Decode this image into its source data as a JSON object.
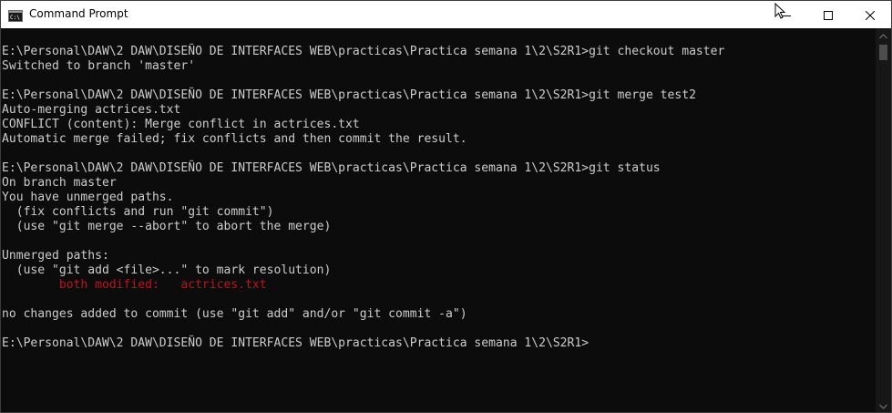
{
  "window": {
    "title": "Command Prompt",
    "icon": "cmd-icon"
  },
  "controls": {
    "minimize_icon": "minimize-icon",
    "maximize_icon": "maximize-icon",
    "close_icon": "close-icon"
  },
  "colors": {
    "console_bg": "#0c0c0c",
    "console_text": "#cccccc",
    "error_text": "#c50f1f",
    "titlebar_bg": "#ffffff"
  },
  "console": {
    "lines": [
      {
        "text": "E:\\Personal\\DAW\\2 DAW\\DISEÑO DE INTERFACES WEB\\practicas\\Practica semana 1\\2\\S2R1>git checkout master"
      },
      {
        "text": "Switched to branch 'master'"
      },
      {
        "text": ""
      },
      {
        "text": "E:\\Personal\\DAW\\2 DAW\\DISEÑO DE INTERFACES WEB\\practicas\\Practica semana 1\\2\\S2R1>git merge test2"
      },
      {
        "text": "Auto-merging actrices.txt"
      },
      {
        "text": "CONFLICT (content): Merge conflict in actrices.txt"
      },
      {
        "text": "Automatic merge failed; fix conflicts and then commit the result."
      },
      {
        "text": ""
      },
      {
        "text": "E:\\Personal\\DAW\\2 DAW\\DISEÑO DE INTERFACES WEB\\practicas\\Practica semana 1\\2\\S2R1>git status"
      },
      {
        "text": "On branch master"
      },
      {
        "text": "You have unmerged paths."
      },
      {
        "text": "  (fix conflicts and run \"git commit\")"
      },
      {
        "text": "  (use \"git merge --abort\" to abort the merge)"
      },
      {
        "text": ""
      },
      {
        "text": "Unmerged paths:"
      },
      {
        "text": "  (use \"git add <file>...\" to mark resolution)"
      },
      {
        "text": "        both modified:   actrices.txt",
        "color": "red"
      },
      {
        "text": ""
      },
      {
        "text": "no changes added to commit (use \"git add\" and/or \"git commit -a\")"
      },
      {
        "text": ""
      },
      {
        "text": "E:\\Personal\\DAW\\2 DAW\\DISEÑO DE INTERFACES WEB\\practicas\\Practica semana 1\\2\\S2R1>"
      }
    ]
  }
}
